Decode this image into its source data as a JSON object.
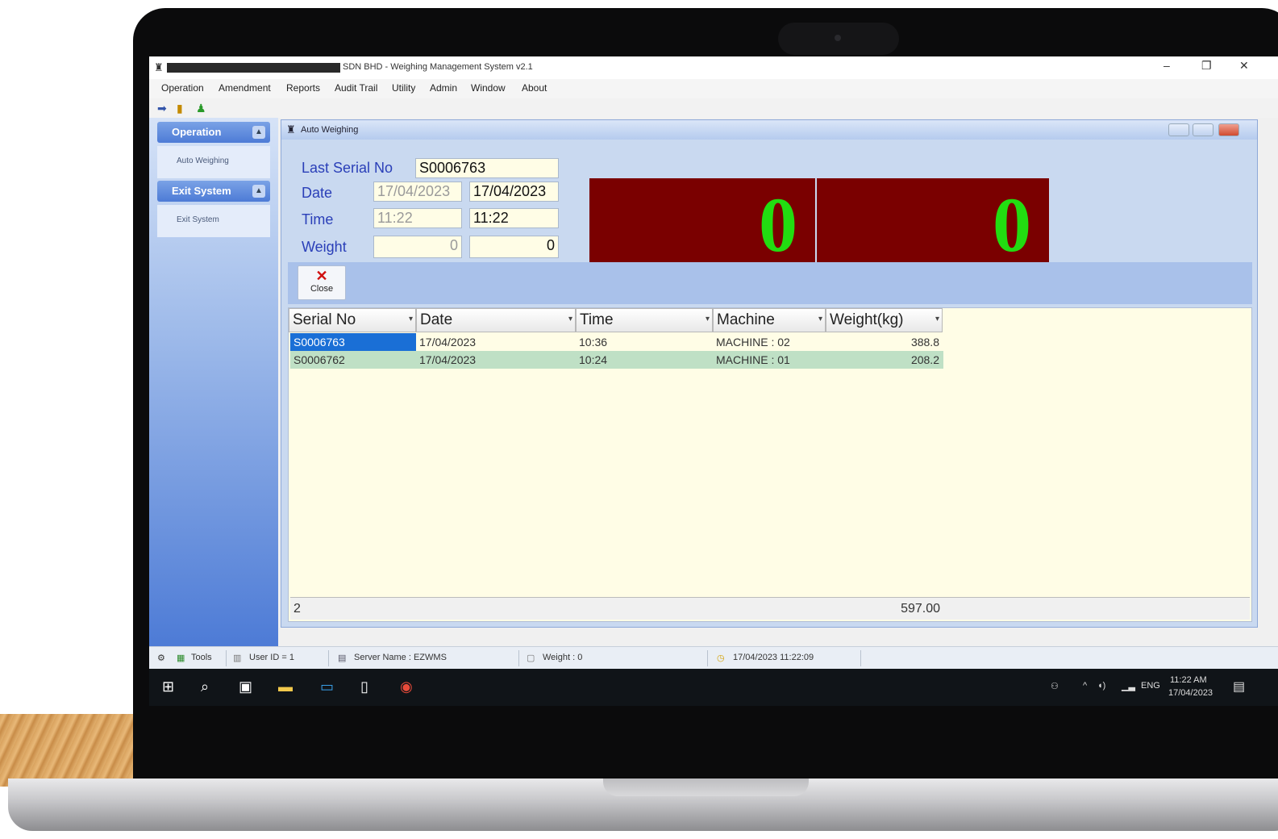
{
  "window": {
    "title": "SDN BHD - Weighing Management System v2.1",
    "controls": [
      "–",
      "❐",
      "✕"
    ]
  },
  "menu": [
    "Operation",
    "Amendment",
    "Reports",
    "Audit Trail",
    "Utility",
    "Admin",
    "Window",
    "About"
  ],
  "sidebar": {
    "groups": [
      {
        "label": "Operation",
        "items": [
          {
            "label": "Auto Weighing"
          }
        ]
      },
      {
        "label": "Exit System",
        "items": [
          {
            "label": "Exit System"
          }
        ]
      }
    ]
  },
  "child_window": {
    "title": "Auto Weighing"
  },
  "form": {
    "last_serial_label": "Last Serial No",
    "last_serial_value": "S0006763",
    "date_label": "Date",
    "date_prev": "17/04/2023",
    "date_current": "17/04/2023",
    "time_label": "Time",
    "time_prev": "11:22",
    "time_current": "11:22",
    "weight_label": "Weight",
    "weight_prev": "0",
    "weight_current": "0"
  },
  "displays": [
    {
      "value": "0"
    },
    {
      "value": "0"
    }
  ],
  "toolbar": {
    "close_label": "Close",
    "close_icon": "✕"
  },
  "grid": {
    "columns": [
      "Serial No",
      "Date",
      "Time",
      "Machine",
      "Weight(kg)"
    ],
    "rows": [
      {
        "serial": "S0006763",
        "date": "17/04/2023",
        "time": "10:36",
        "machine": "MACHINE : 02",
        "weight": "388.8"
      },
      {
        "serial": "S0006762",
        "date": "17/04/2023",
        "time": "10:24",
        "machine": "MACHINE : 01",
        "weight": "208.2"
      }
    ],
    "footer_count": "2",
    "footer_total": "597.00"
  },
  "statusbar": {
    "tools": "Tools",
    "user": "User ID = 1",
    "server": "Server Name : EZWMS",
    "weight": "Weight : 0",
    "datetime": "17/04/2023 11:22:09"
  },
  "taskbar": {
    "lang": "ENG",
    "time": "11:22 AM",
    "date": "17/04/2023"
  },
  "colors": {
    "display_bg": "#7a0000",
    "display_digit": "#22dd11",
    "label_blue": "#2a3fb8",
    "grid_bg": "#fffde6",
    "selected_row": "#1a6fd6"
  }
}
